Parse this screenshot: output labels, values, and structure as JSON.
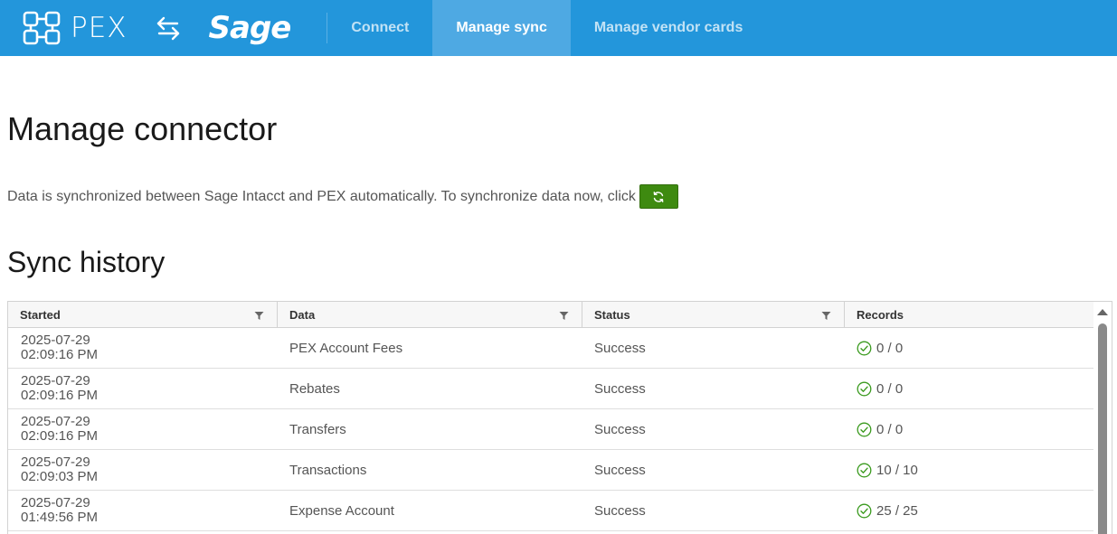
{
  "header": {
    "pex_wordmark": "PEX",
    "sage_wordmark": "Sage",
    "brand_color": "#2396db",
    "tabs": [
      {
        "label": "Connect",
        "active": false
      },
      {
        "label": "Manage sync",
        "active": true
      },
      {
        "label": "Manage vendor cards",
        "active": false
      }
    ]
  },
  "main": {
    "title": "Manage connector",
    "sync_text": "Data is synchronized between Sage Intacct and PEX automatically. To synchronize data now, click",
    "sync_button_icon": "refresh-icon",
    "sync_button_color": "#3e8a10",
    "history_title": "Sync history"
  },
  "grid": {
    "columns": [
      "Started",
      "Data",
      "Status",
      "Records"
    ],
    "rows": [
      {
        "date": "2025-07-29",
        "time": "02:09:16 PM",
        "data": "PEX Account Fees",
        "status": "Success",
        "records": "0 / 0"
      },
      {
        "date": "2025-07-29",
        "time": "02:09:16 PM",
        "data": "Rebates",
        "status": "Success",
        "records": "0 / 0"
      },
      {
        "date": "2025-07-29",
        "time": "02:09:16 PM",
        "data": "Transfers",
        "status": "Success",
        "records": "0 / 0"
      },
      {
        "date": "2025-07-29",
        "time": "02:09:03 PM",
        "data": "Transactions",
        "status": "Success",
        "records": "10 / 10"
      },
      {
        "date": "2025-07-29",
        "time": "01:49:56 PM",
        "data": "Expense Account",
        "status": "Success",
        "records": "25 / 25"
      }
    ],
    "success_icon": "check-circle-icon",
    "success_color": "#3a9a1e"
  }
}
